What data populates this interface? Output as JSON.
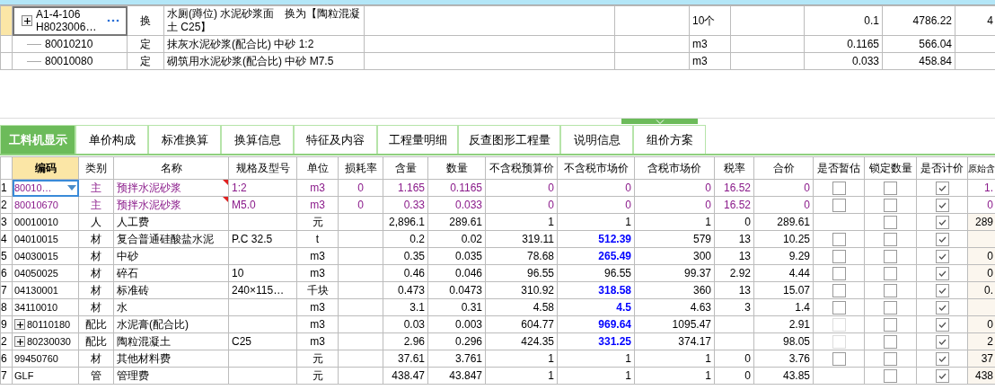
{
  "top": {
    "rows": [
      {
        "selected": true,
        "expandable": true,
        "code_lines": [
          "A1-4-106",
          "H8023006…"
        ],
        "type": "换",
        "name": "水厕(蹲位) 水泥砂浆面　换为【陶粒混凝土 C25】",
        "unit": "10个",
        "content": "0.1",
        "price": "4786.22",
        "extra": "4"
      },
      {
        "selected": false,
        "expandable": false,
        "code_lines": [
          "80010210"
        ],
        "type": "定",
        "name": "抹灰水泥砂浆(配合比) 中砂 1:2",
        "unit": "m3",
        "content": "0.1165",
        "price": "566.04",
        "extra": ""
      },
      {
        "selected": false,
        "expandable": false,
        "code_lines": [
          "80010080"
        ],
        "type": "定",
        "name": "砌筑用水泥砂浆(配合比) 中砂 M7.5",
        "unit": "m3",
        "content": "0.033",
        "price": "458.84",
        "extra": ""
      }
    ]
  },
  "tabs": [
    {
      "label": "工料机显示",
      "selected": true
    },
    {
      "label": "单价构成",
      "selected": false
    },
    {
      "label": "标准换算",
      "selected": false
    },
    {
      "label": "换算信息",
      "selected": false
    },
    {
      "label": "特征及内容",
      "selected": false
    },
    {
      "label": "工程量明细",
      "selected": false
    },
    {
      "label": "反查图形工程量",
      "selected": false
    },
    {
      "label": "说明信息",
      "selected": false
    },
    {
      "label": "组价方案",
      "selected": false
    }
  ],
  "bottom": {
    "columns": [
      "编码",
      "类别",
      "名称",
      "规格及型号",
      "单位",
      "损耗率",
      "含量",
      "数量",
      "不含税预算价",
      "不含税市场价",
      "含税市场价",
      "税率",
      "合价",
      "是否暂估",
      "锁定数量",
      "是否计价",
      "原始含"
    ],
    "rows": [
      {
        "num": "1",
        "selected": true,
        "highlight": true,
        "flagged": true,
        "expandable": false,
        "code": "80010…",
        "type": "主",
        "name": "预拌水泥砂浆",
        "spec": "1:2",
        "unit": "m3",
        "loss": "0",
        "content": "1.165",
        "qty": "0.1165",
        "budget": "0",
        "market": "0",
        "market_changed": false,
        "tax_market": "0",
        "tax_rate": "16.52",
        "total": "0",
        "provisional": {
          "checked": false,
          "disabled": false
        },
        "locked": {
          "checked": false
        },
        "priced": {
          "checked": true
        },
        "original": "1."
      },
      {
        "num": "2",
        "selected": false,
        "highlight": true,
        "flagged": true,
        "expandable": false,
        "code": "80010670",
        "type": "主",
        "name": "预拌水泥砂浆",
        "spec": "M5.0",
        "unit": "m3",
        "loss": "0",
        "content": "0.33",
        "qty": "0.033",
        "budget": "0",
        "market": "0",
        "market_changed": false,
        "tax_market": "0",
        "tax_rate": "16.52",
        "total": "0",
        "provisional": {
          "checked": false,
          "disabled": false
        },
        "locked": {
          "checked": false
        },
        "priced": {
          "checked": true
        },
        "original": "0"
      },
      {
        "num": "3",
        "selected": false,
        "highlight": false,
        "flagged": false,
        "expandable": false,
        "code": "00010010",
        "type": "人",
        "name": "人工费",
        "spec": "",
        "unit": "元",
        "loss": "",
        "content": "2,896.1",
        "qty": "289.61",
        "budget": "1",
        "market": "1",
        "market_changed": false,
        "tax_market": "1",
        "tax_rate": "0",
        "total": "289.61",
        "provisional": null,
        "locked": {
          "checked": false
        },
        "priced": {
          "checked": true
        },
        "original": "289"
      },
      {
        "num": "4",
        "selected": false,
        "highlight": false,
        "flagged": false,
        "expandable": false,
        "code": "04010015",
        "type": "材",
        "name": "复合普通硅酸盐水泥",
        "spec": "P.C 32.5",
        "unit": "t",
        "loss": "",
        "content": "0.2",
        "qty": "0.02",
        "budget": "319.11",
        "market": "512.39",
        "market_changed": true,
        "tax_market": "579",
        "tax_rate": "13",
        "total": "10.25",
        "provisional": {
          "checked": false,
          "disabled": false
        },
        "locked": {
          "checked": false
        },
        "priced": {
          "checked": true
        },
        "original": ""
      },
      {
        "num": "5",
        "selected": false,
        "highlight": false,
        "flagged": false,
        "expandable": false,
        "code": "04030015",
        "type": "材",
        "name": "中砂",
        "spec": "",
        "unit": "m3",
        "loss": "",
        "content": "0.35",
        "qty": "0.035",
        "budget": "78.68",
        "market": "265.49",
        "market_changed": true,
        "tax_market": "300",
        "tax_rate": "13",
        "total": "9.29",
        "provisional": {
          "checked": false,
          "disabled": false
        },
        "locked": {
          "checked": false
        },
        "priced": {
          "checked": true
        },
        "original": "0"
      },
      {
        "num": "6",
        "selected": false,
        "highlight": false,
        "flagged": false,
        "expandable": false,
        "code": "04050025",
        "type": "材",
        "name": "碎石",
        "spec": "10",
        "unit": "m3",
        "loss": "",
        "content": "0.46",
        "qty": "0.046",
        "budget": "96.55",
        "market": "96.55",
        "market_changed": false,
        "tax_market": "99.37",
        "tax_rate": "2.92",
        "total": "4.44",
        "provisional": {
          "checked": false,
          "disabled": false
        },
        "locked": {
          "checked": false
        },
        "priced": {
          "checked": true
        },
        "original": "0"
      },
      {
        "num": "7",
        "selected": false,
        "highlight": false,
        "flagged": false,
        "expandable": false,
        "code": "04130001",
        "type": "材",
        "name": "标准砖",
        "spec": "240×115…",
        "unit": "千块",
        "loss": "",
        "content": "0.473",
        "qty": "0.0473",
        "budget": "310.92",
        "market": "318.58",
        "market_changed": true,
        "tax_market": "360",
        "tax_rate": "13",
        "total": "15.07",
        "provisional": {
          "checked": false,
          "disabled": false
        },
        "locked": {
          "checked": false
        },
        "priced": {
          "checked": true
        },
        "original": "0."
      },
      {
        "num": "8",
        "selected": false,
        "highlight": false,
        "flagged": false,
        "expandable": false,
        "code": "34110010",
        "type": "材",
        "name": "水",
        "spec": "",
        "unit": "m3",
        "loss": "",
        "content": "3.1",
        "qty": "0.31",
        "budget": "4.58",
        "market": "4.5",
        "market_changed": true,
        "tax_market": "4.63",
        "tax_rate": "3",
        "total": "1.4",
        "provisional": {
          "checked": false,
          "disabled": false
        },
        "locked": {
          "checked": false
        },
        "priced": {
          "checked": true
        },
        "original": ""
      },
      {
        "num": "9",
        "selected": false,
        "highlight": false,
        "flagged": false,
        "expandable": true,
        "code": "80110180",
        "type": "配比",
        "name": "水泥膏(配合比)",
        "spec": "",
        "unit": "m3",
        "loss": "",
        "content": "0.03",
        "qty": "0.003",
        "budget": "604.77",
        "market": "969.64",
        "market_changed": true,
        "tax_market": "1095.47",
        "tax_rate": "",
        "total": "2.91",
        "provisional": {
          "checked": false,
          "disabled": true
        },
        "locked": {
          "checked": false
        },
        "priced": {
          "checked": true
        },
        "original": "0"
      },
      {
        "num": "2",
        "selected": false,
        "highlight": false,
        "flagged": false,
        "expandable": true,
        "code": "80230030",
        "type": "配比",
        "name": "陶粒混凝土",
        "spec": "C25",
        "unit": "m3",
        "loss": "",
        "content": "2.96",
        "qty": "0.296",
        "budget": "424.35",
        "market": "331.25",
        "market_changed": true,
        "tax_market": "374.17",
        "tax_rate": "",
        "total": "98.05",
        "provisional": {
          "checked": false,
          "disabled": true
        },
        "locked": {
          "checked": false
        },
        "priced": {
          "checked": true
        },
        "original": "2"
      },
      {
        "num": "6",
        "selected": false,
        "highlight": false,
        "flagged": false,
        "expandable": false,
        "code": "99450760",
        "type": "材",
        "name": "其他材料费",
        "spec": "",
        "unit": "元",
        "loss": "",
        "content": "37.61",
        "qty": "3.761",
        "budget": "1",
        "market": "1",
        "market_changed": false,
        "tax_market": "1",
        "tax_rate": "0",
        "total": "3.76",
        "provisional": {
          "checked": false,
          "disabled": false
        },
        "locked": {
          "checked": false
        },
        "priced": {
          "checked": true
        },
        "original": "37"
      },
      {
        "num": "7",
        "selected": false,
        "highlight": false,
        "flagged": false,
        "expandable": false,
        "code": "GLF",
        "type": "管",
        "name": "管理费",
        "spec": "",
        "unit": "元",
        "loss": "",
        "content": "438.47",
        "qty": "43.847",
        "budget": "1",
        "market": "1",
        "market_changed": false,
        "tax_market": "1",
        "tax_rate": "0",
        "total": "43.85",
        "provisional": null,
        "locked": {
          "checked": false
        },
        "priced": {
          "checked": true
        },
        "original": "438"
      }
    ]
  }
}
